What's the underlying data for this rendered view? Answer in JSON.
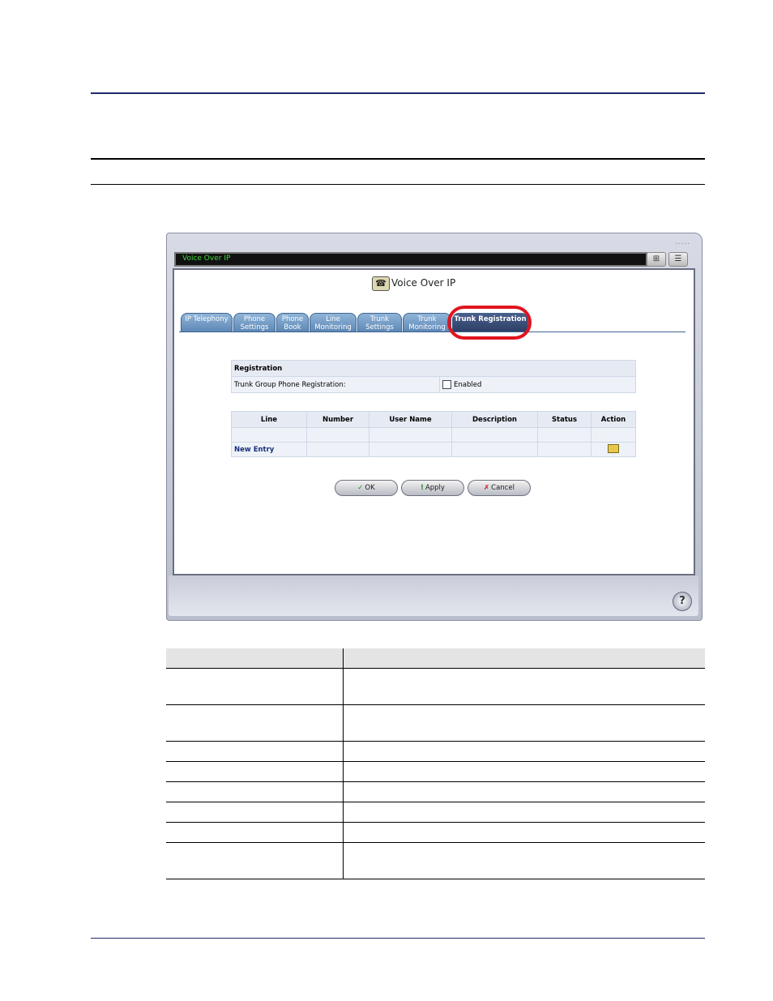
{
  "window": {
    "title": "Voice Over IP",
    "grip": "....."
  },
  "page": {
    "heading": "Voice Over IP",
    "phone_icon": "telephone-icon"
  },
  "tabs": [
    {
      "label": "IP Telephony",
      "active": false
    },
    {
      "label": "Phone Settings",
      "active": false
    },
    {
      "label": "Phone Book",
      "active": false
    },
    {
      "label": "Line Monitoring",
      "active": false
    },
    {
      "label": "Trunk Settings",
      "active": false
    },
    {
      "label": "Trunk Monitoring",
      "active": false
    },
    {
      "label": "Trunk Registration",
      "active": true
    }
  ],
  "registration": {
    "section_title": "Registration",
    "field_label": "Trunk Group Phone Registration:",
    "checkbox_label": "Enabled",
    "checked": false
  },
  "lines_table": {
    "headers": [
      "Line",
      "Number",
      "User Name",
      "Description",
      "Status",
      "Action"
    ],
    "new_entry": "New Entry"
  },
  "buttons": {
    "ok": "OK",
    "apply": "Apply",
    "cancel": "Cancel"
  },
  "help": "?",
  "colors": {
    "tab": "#5e88b6",
    "tab_active": "#2d3f66",
    "highlight": "#e0141e",
    "title_text": "#41d641"
  }
}
